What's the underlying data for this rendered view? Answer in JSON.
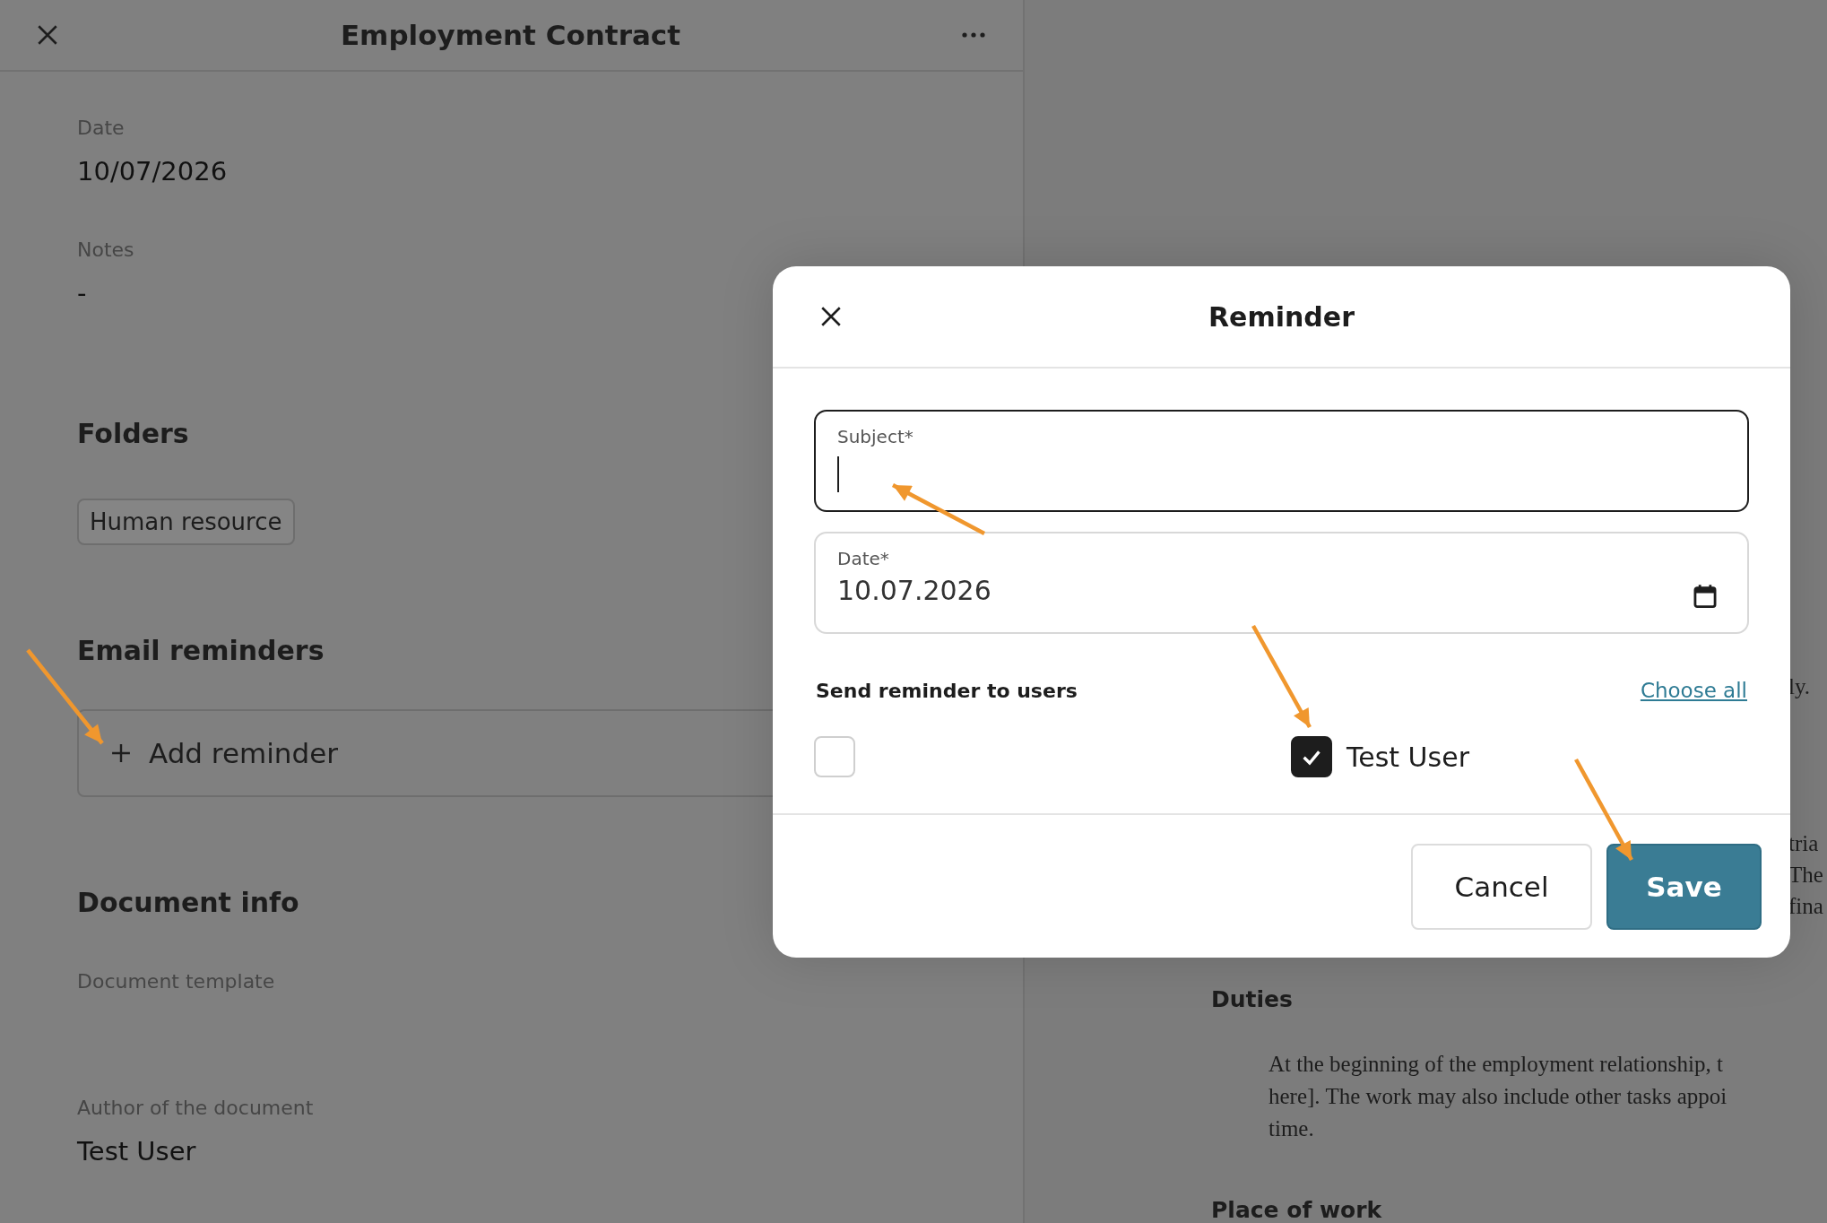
{
  "panel": {
    "title": "Employment Contract",
    "fields": [
      {
        "label": "Date",
        "value": "10/07/2026"
      },
      {
        "label": "Notes",
        "value": "-"
      }
    ],
    "folders": {
      "heading": "Folders",
      "tags": [
        "Human resource"
      ]
    },
    "email_reminders": {
      "heading": "Email reminders",
      "add_button": "Add reminder"
    },
    "document_info": {
      "heading": "Document info",
      "fields": [
        {
          "label": "Document template"
        },
        {
          "label": "Author of the document",
          "value": "Test User"
        }
      ]
    }
  },
  "document": {
    "fragments": [
      "ly.",
      "tria",
      "The",
      "fina"
    ],
    "heading": "Duties",
    "lines": [
      "At the beginning of the employment relationship, t",
      "here]. The work may also include other tasks appoi",
      "time."
    ],
    "next_heading": "Place of work"
  },
  "dialog": {
    "title": "Reminder",
    "subject": {
      "label": "Subject*",
      "focused": true
    },
    "date": {
      "label": "Date*",
      "value": "10.07.2026"
    },
    "users_label": "Send reminder to users",
    "choose_all": "Choose all",
    "users": [
      {
        "checked": false
      },
      {
        "name": "Test User",
        "checked": true
      }
    ],
    "buttons": [
      {
        "label": "Cancel",
        "kind": "secondary"
      },
      {
        "label": "Save",
        "kind": "primary"
      }
    ]
  }
}
